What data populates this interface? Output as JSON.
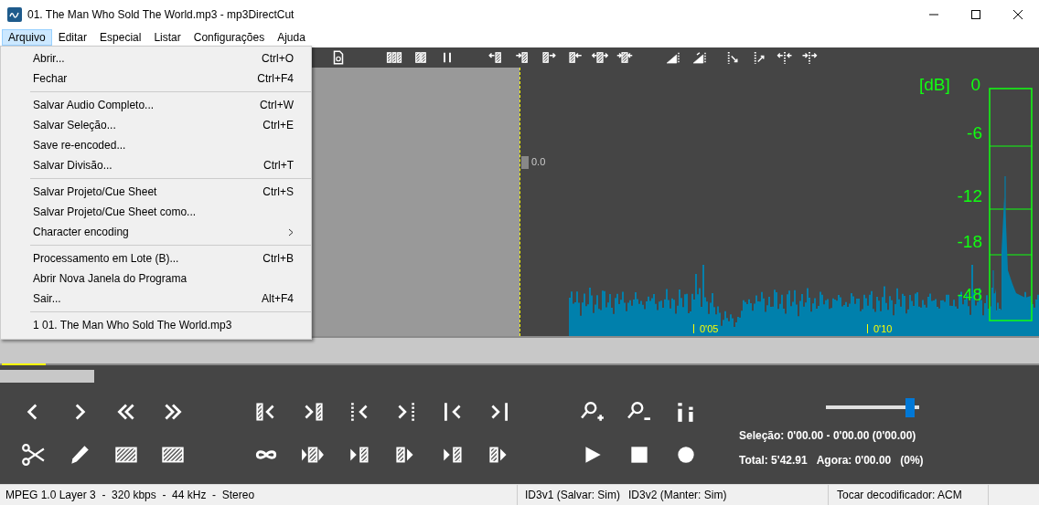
{
  "window": {
    "title": "01. The Man Who Sold The World.mp3 - mp3DirectCut"
  },
  "menu_bar": [
    {
      "label": "Arquivo",
      "selected": true
    },
    {
      "label": "Editar",
      "selected": false
    },
    {
      "label": "Especial",
      "selected": false
    },
    {
      "label": "Listar",
      "selected": false
    },
    {
      "label": "Configurações",
      "selected": false
    },
    {
      "label": "Ajuda",
      "selected": false
    }
  ],
  "file_menu": [
    {
      "kind": "item",
      "label": "Abrir...",
      "shortcut": "Ctrl+O"
    },
    {
      "kind": "item",
      "label": "Fechar",
      "shortcut": "Ctrl+F4"
    },
    {
      "kind": "separator"
    },
    {
      "kind": "item",
      "label": "Salvar Audio Completo...",
      "shortcut": "Ctrl+W"
    },
    {
      "kind": "item",
      "label": "Salvar Seleção...",
      "shortcut": "Ctrl+E"
    },
    {
      "kind": "item",
      "label": "Save re-encoded..."
    },
    {
      "kind": "item",
      "label": "Salvar Divisão...",
      "shortcut": "Ctrl+T"
    },
    {
      "kind": "separator"
    },
    {
      "kind": "item",
      "label": "Salvar Projeto/Cue Sheet",
      "shortcut": "Ctrl+S"
    },
    {
      "kind": "item",
      "label": "Salvar Projeto/Cue Sheet como..."
    },
    {
      "kind": "submenu",
      "label": "Character encoding"
    },
    {
      "kind": "separator"
    },
    {
      "kind": "item",
      "label": "Processamento em Lote (B)...",
      "shortcut": "Ctrl+B"
    },
    {
      "kind": "item",
      "label": "Abrir Nova Janela do Programa"
    },
    {
      "kind": "item",
      "label": "Sair...",
      "shortcut": "Alt+F4"
    },
    {
      "kind": "separator"
    },
    {
      "kind": "item",
      "label": "1 01. The Man Who Sold The World.mp3"
    }
  ],
  "waveform": {
    "position_label": "0.0",
    "time_marks": [
      "0'05",
      "0'10"
    ],
    "db_unit": "[dB]",
    "db_ticks": [
      "0",
      "-6",
      "-12",
      "-18",
      "-48"
    ]
  },
  "slider": {
    "level": 0.95
  },
  "selection": "Seleção: 0'00.00 - 0'00.00 (0'00.00)",
  "totals": [
    "Total: 5'42.91",
    "Agora: 0'00.00",
    "(0%)"
  ],
  "status_bar": {
    "format": "MPEG 1.0 Layer 3  -  320 kbps  -  44 kHz  -  Stereo",
    "tags": [
      "ID3v1 (Salvar: Sim)",
      "ID3v2 (Manter: Sim)"
    ],
    "decoder": "Tocar decodificador: ACM"
  }
}
